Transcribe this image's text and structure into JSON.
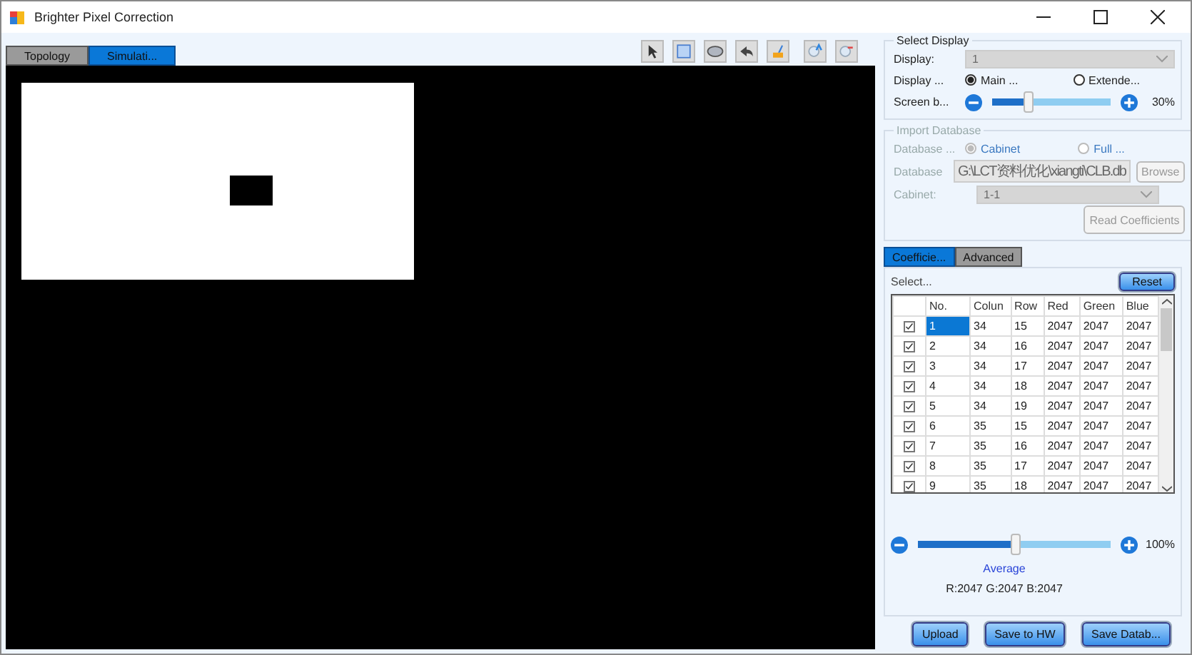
{
  "window": {
    "title": "Brighter Pixel Correction"
  },
  "tabs": [
    {
      "label": "Topology",
      "selected": false
    },
    {
      "label": "Simulati...",
      "selected": true
    }
  ],
  "select_display": {
    "title": "Select Display",
    "display": {
      "label": "Display:",
      "value": "1"
    },
    "display_mode": {
      "label": "Display ...",
      "options": [
        {
          "label": "Main ...",
          "selected": true
        },
        {
          "label": "Extende...",
          "selected": false
        }
      ]
    },
    "brightness": {
      "label": "Screen b...",
      "level": 0.3,
      "reading": "30%"
    }
  },
  "import_database": {
    "title": "Import Database",
    "disabled": true,
    "database_type": {
      "label": "Database ...",
      "options": [
        {
          "label": "Cabinet",
          "selected": true
        },
        {
          "label": "Full ...",
          "selected": false
        }
      ]
    },
    "database": {
      "label": "Database",
      "value": "G:\\LCT资料优化\\xiangti\\CLB.db"
    },
    "browse": "Browse",
    "cabinet": {
      "label": "Cabinet:",
      "value": "1-1"
    },
    "read_button": "Read Coefficients"
  },
  "panel_tabs": [
    {
      "label": "Coefficie...",
      "selected": true
    },
    {
      "label": "Advanced",
      "selected": false
    }
  ],
  "select_label": "Select...",
  "reset": "Reset",
  "table": {
    "columns": [
      "No.",
      "Colun",
      "Row",
      "Red",
      "Green",
      "Blue"
    ],
    "rows": [
      {
        "checked": true,
        "selected": true,
        "cells": [
          "1",
          "34",
          "15",
          "2047",
          "2047",
          "2047"
        ]
      },
      {
        "checked": true,
        "selected": false,
        "cells": [
          "2",
          "34",
          "16",
          "2047",
          "2047",
          "2047"
        ]
      },
      {
        "checked": true,
        "selected": false,
        "cells": [
          "3",
          "34",
          "17",
          "2047",
          "2047",
          "2047"
        ]
      },
      {
        "checked": true,
        "selected": false,
        "cells": [
          "4",
          "34",
          "18",
          "2047",
          "2047",
          "2047"
        ]
      },
      {
        "checked": true,
        "selected": false,
        "cells": [
          "5",
          "34",
          "19",
          "2047",
          "2047",
          "2047"
        ]
      },
      {
        "checked": true,
        "selected": false,
        "cells": [
          "6",
          "35",
          "15",
          "2047",
          "2047",
          "2047"
        ]
      },
      {
        "checked": true,
        "selected": false,
        "cells": [
          "7",
          "35",
          "16",
          "2047",
          "2047",
          "2047"
        ]
      },
      {
        "checked": true,
        "selected": false,
        "cells": [
          "8",
          "35",
          "17",
          "2047",
          "2047",
          "2047"
        ]
      },
      {
        "checked": true,
        "selected": false,
        "cells": [
          "9",
          "35",
          "18",
          "2047",
          "2047",
          "2047"
        ]
      }
    ]
  },
  "average": {
    "level": 0.5,
    "reading": "100%",
    "caption": "Average",
    "values": "R:2047 G:2047 B:2047"
  },
  "buttons": [
    "Upload",
    "Save to HW",
    "Save Datab..."
  ]
}
